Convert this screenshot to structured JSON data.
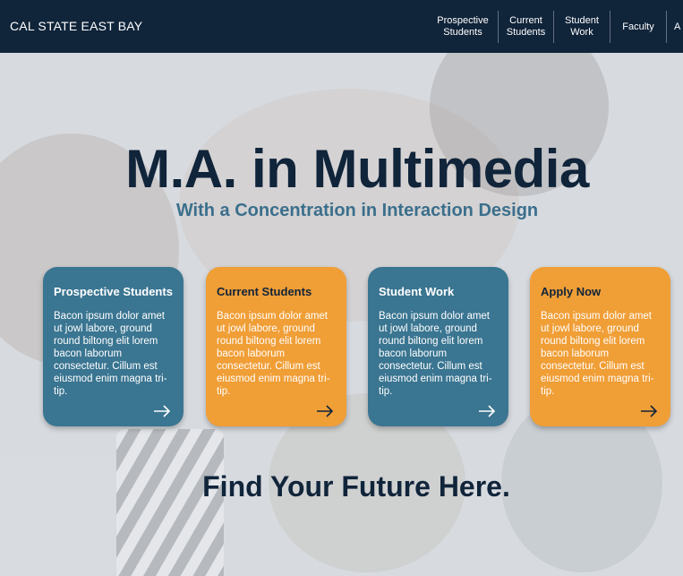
{
  "header": {
    "brand": "CAL STATE EAST BAY",
    "nav": [
      {
        "line1": "Prospective",
        "line2": "Students"
      },
      {
        "line1": "Current",
        "line2": "Students"
      },
      {
        "line1": "Student",
        "line2": "Work"
      },
      {
        "line1": "Faculty",
        "line2": ""
      },
      {
        "line1": "A",
        "line2": ""
      }
    ]
  },
  "hero": {
    "title": "M.A. in Multimedia",
    "subtitle": "With a Concentration in Interaction Design"
  },
  "cards": [
    {
      "title": "Prospective Students",
      "body": "Bacon ipsum dolor amet ut jowl labore, ground round biltong elit lorem bacon laborum consectetur. Cillum est eiusmod enim magna tri-tip.",
      "color": "teal",
      "icon": "arrow-right-icon"
    },
    {
      "title": "Current Students",
      "body": "Bacon ipsum dolor amet ut jowl labore, ground round biltong elit lorem bacon laborum consectetur. Cillum est eiusmod enim magna tri-tip.",
      "color": "orange",
      "icon": "arrow-right-icon"
    },
    {
      "title": "Student Work",
      "body": "Bacon ipsum dolor amet ut jowl labore, ground round biltong elit lorem bacon laborum consectetur. Cillum est eiusmod enim magna tri-tip.",
      "color": "teal",
      "icon": "arrow-right-icon"
    },
    {
      "title": "Apply Now",
      "body": "Bacon ipsum dolor amet ut jowl labore, ground round biltong elit lorem bacon laborum consectetur. Cillum est eiusmod enim magna tri-tip.",
      "color": "orange",
      "icon": "arrow-right-icon"
    }
  ],
  "tagline": "Find Your Future Here.",
  "colors": {
    "navy": "#10243a",
    "teal": "#3a7591",
    "orange": "#f09e36",
    "subtitle": "#3b6f8c"
  }
}
